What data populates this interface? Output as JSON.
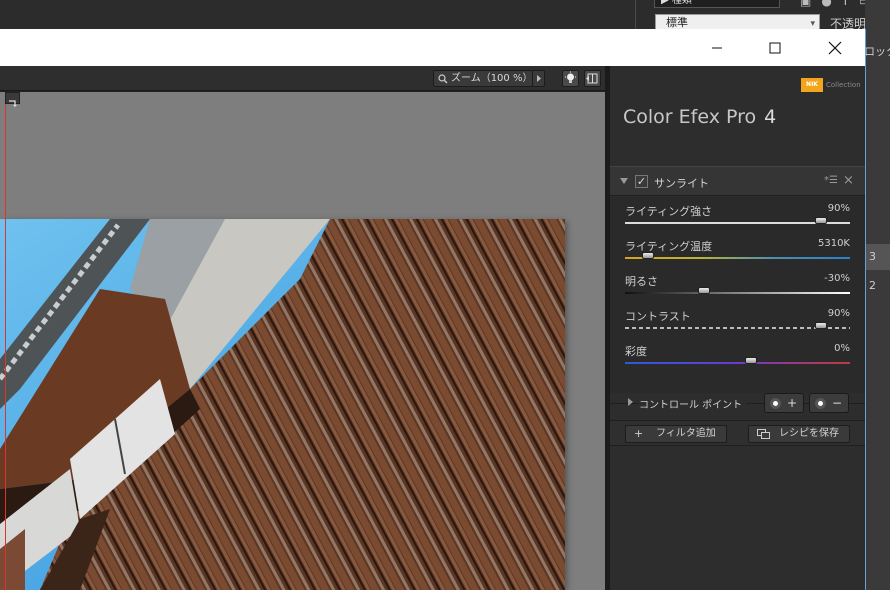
{
  "host": {
    "mode_label": "標準",
    "top_field": "▶ 種類",
    "opacity_label": "不透明度：",
    "lock_label": "ロック：",
    "layer_numbers": [
      "3",
      "2"
    ]
  },
  "window": {
    "titlebar": {
      "minimize_glyph": "—",
      "maximize_glyph": "☐",
      "close_glyph": "✕"
    }
  },
  "preview": {
    "zoom_label": "ズーム（100 %）"
  },
  "panel": {
    "logo_mark": "NIK",
    "logo_text": "Collection",
    "app_name": "Color Efex Pro",
    "app_version": "4",
    "filter": {
      "name": "サンライト",
      "enabled": true
    },
    "sliders": [
      {
        "label": "ライティング強さ",
        "value": "90%",
        "position": 0.87
      },
      {
        "label": "ライティング温度",
        "value": "5310K",
        "position": 0.1
      },
      {
        "label": "明るさ",
        "value": "-30%",
        "position": 0.35
      },
      {
        "label": "コントラスト",
        "value": "90%",
        "position": 0.87
      },
      {
        "label": "彩度",
        "value": "0%",
        "position": 0.56
      }
    ],
    "control_points": {
      "label": "コントロール ポイント",
      "add_symbol": "+",
      "remove_symbol": "−"
    },
    "add_filter_label": "フィルタ追加",
    "save_recipe_label": "レシピを保存"
  },
  "colors": {
    "accent_logo": "#f2a51b",
    "panel_bg": "#2d2d2d",
    "canvas_bg": "#7e7e7e",
    "guide_line": "#dd3333"
  }
}
